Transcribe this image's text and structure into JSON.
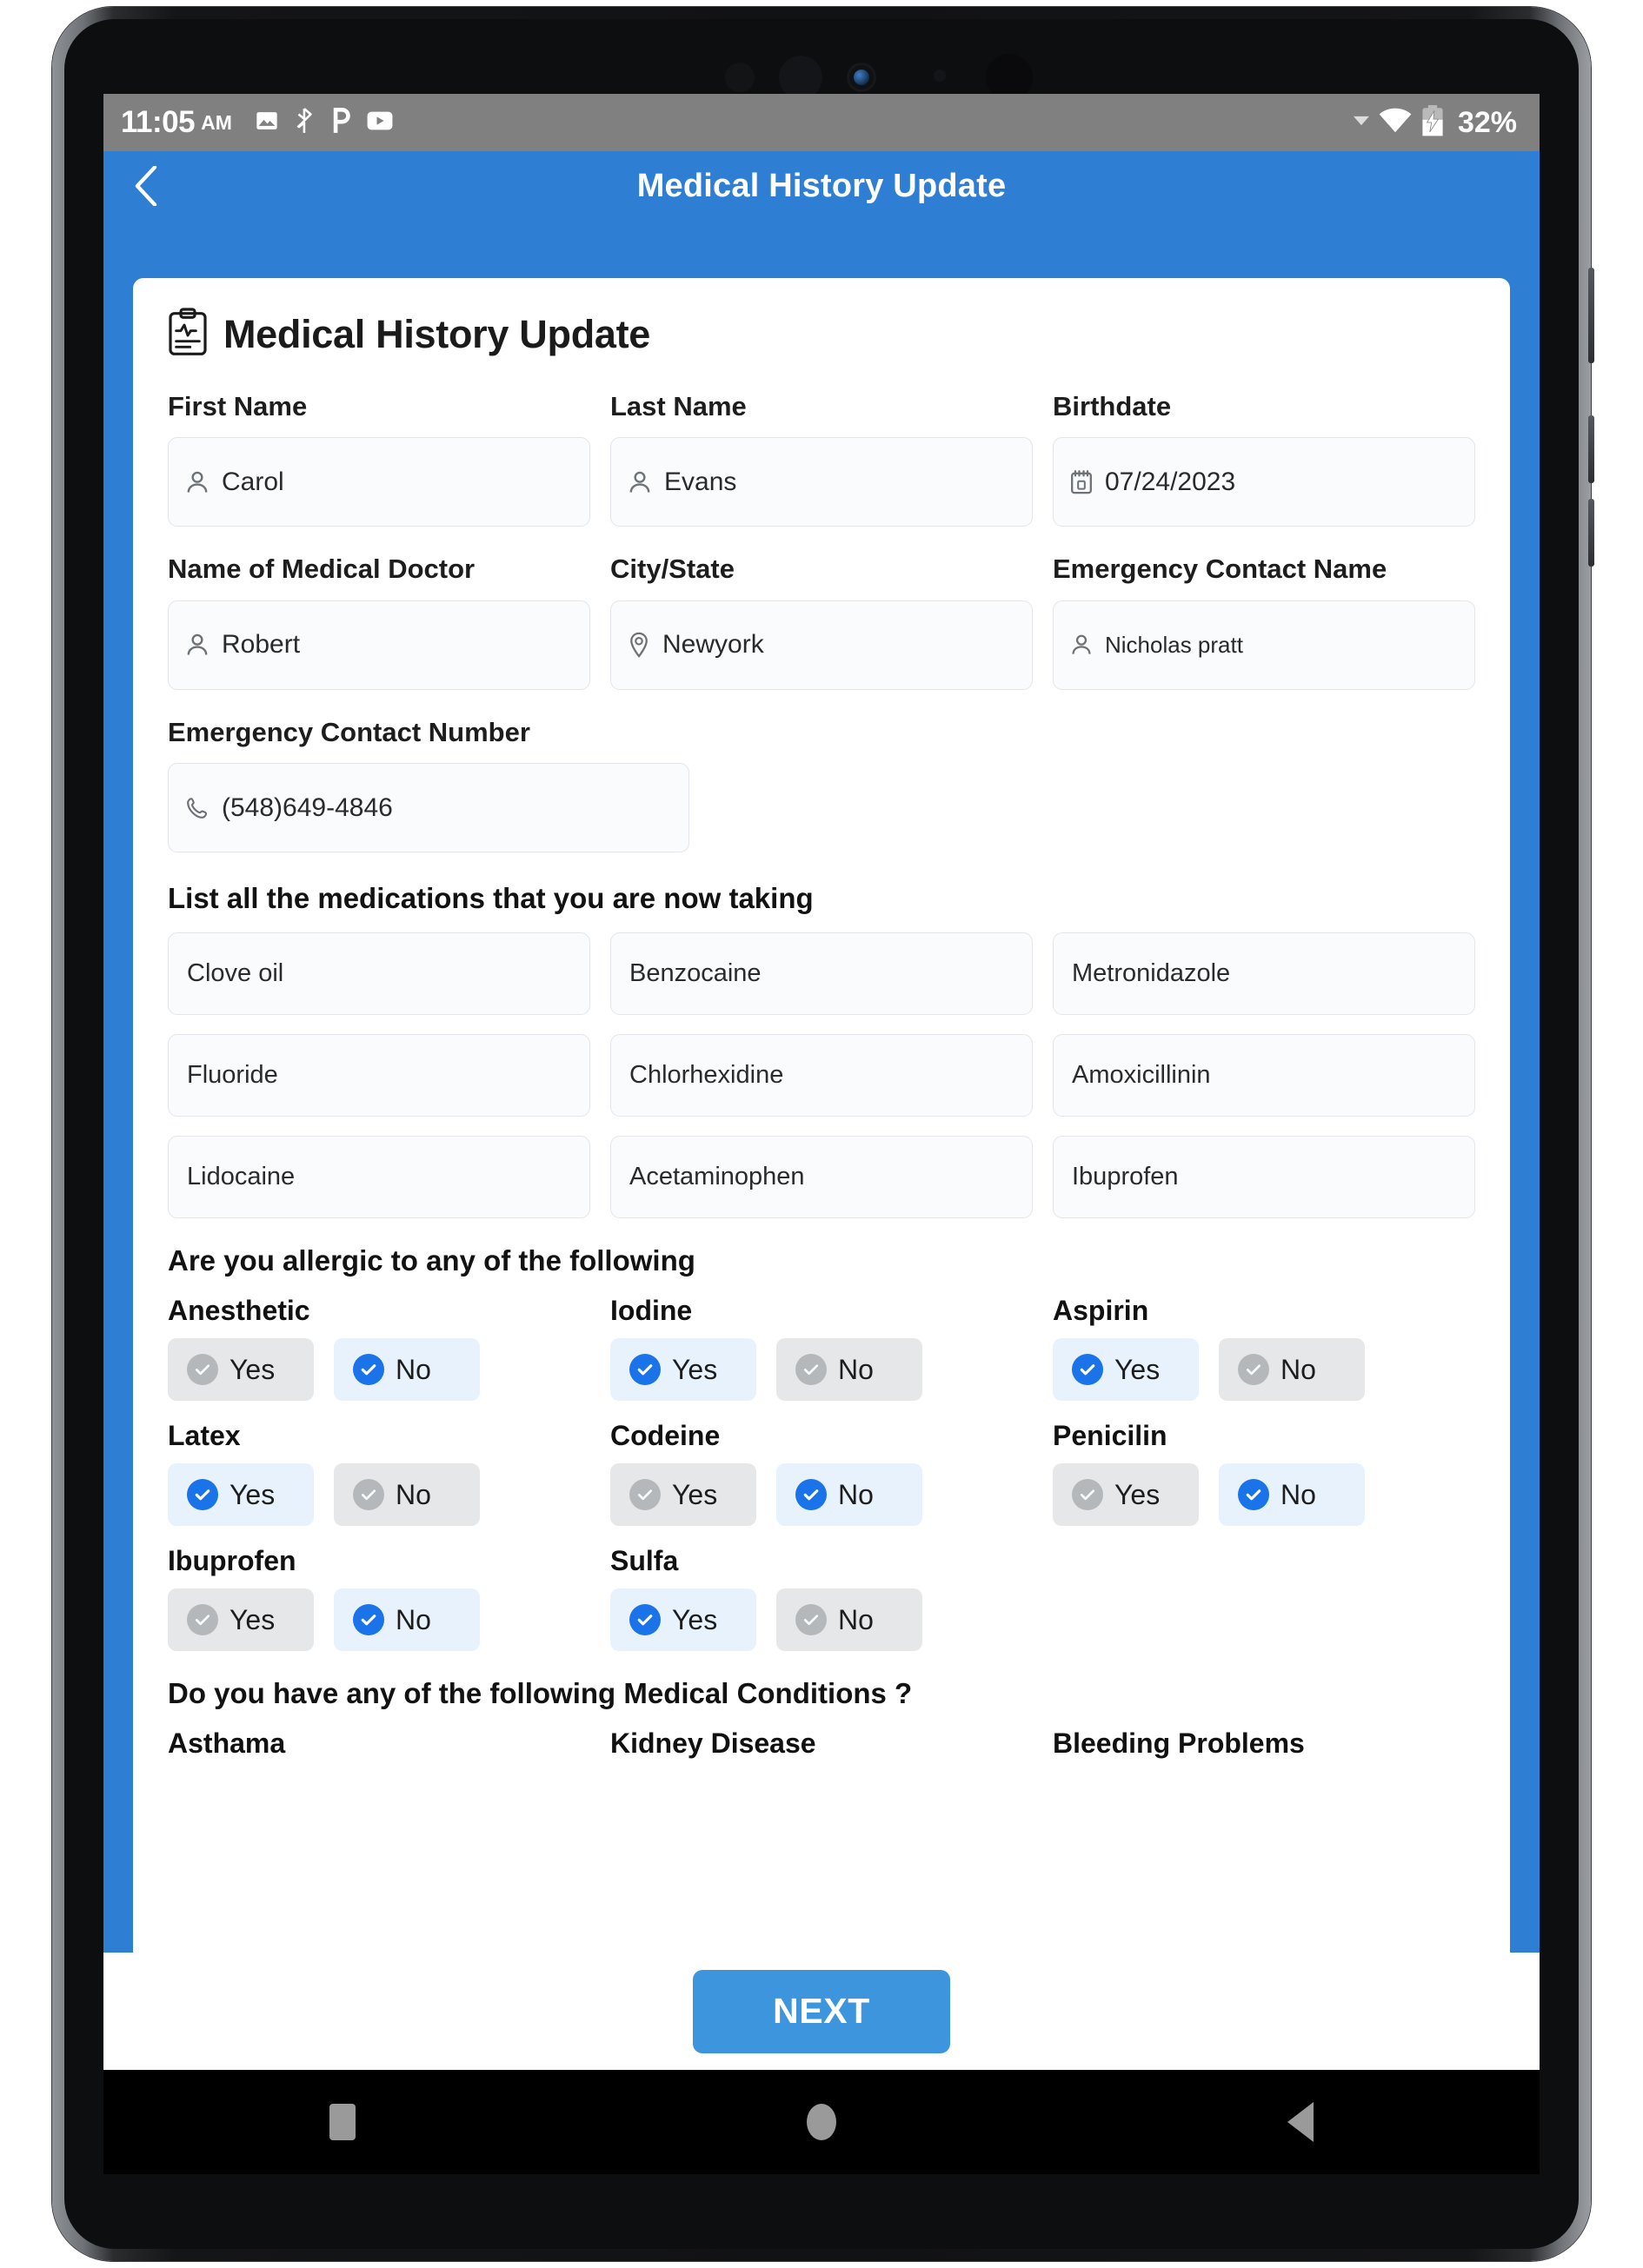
{
  "status_bar": {
    "time": "11:05",
    "ampm": "AM",
    "battery_percent": "32%",
    "left_icons": [
      "image-icon",
      "bluetooth-icon",
      "p-app-icon",
      "youtube-icon"
    ],
    "right_icons": [
      "dropdown-caret-icon",
      "wifi-icon",
      "battery-charging-icon"
    ]
  },
  "app_bar": {
    "back_icon": "chevron-left-icon",
    "title": "Medical History Update"
  },
  "card": {
    "icon": "clipboard-medical-icon",
    "title": "Medical History Update"
  },
  "form": {
    "first_name": {
      "label": "First Name",
      "value": "Carol",
      "icon": "person-icon"
    },
    "last_name": {
      "label": "Last Name",
      "value": "Evans",
      "icon": "person-icon"
    },
    "birthdate": {
      "label": "Birthdate",
      "value": "07/24/2023",
      "icon": "calendar-icon"
    },
    "doctor_name": {
      "label": "Name of Medical Doctor",
      "value": "Robert",
      "icon": "person-icon"
    },
    "city_state": {
      "label": "City/State",
      "value": "Newyork",
      "icon": "location-pin-icon"
    },
    "emergency_contact_name": {
      "label": "Emergency Contact Name",
      "value": "Nicholas pratt",
      "icon": "person-icon"
    },
    "emergency_contact_number": {
      "label": "Emergency Contact Number",
      "value": "(548)649-4846",
      "icon": "phone-icon"
    }
  },
  "medications": {
    "heading": "List all the medications that you are now taking",
    "items": [
      "Clove oil",
      "Benzocaine",
      "Metronidazole",
      "Fluoride",
      "Chlorhexidine",
      "Amoxicillinin",
      "Lidocaine",
      "Acetaminophen",
      "Ibuprofen"
    ]
  },
  "allergies": {
    "heading": "Are you allergic to any of the following",
    "yes_label": "Yes",
    "no_label": "No",
    "items": [
      {
        "name": "Anesthetic",
        "answer": "No"
      },
      {
        "name": "Iodine",
        "answer": "Yes"
      },
      {
        "name": "Aspirin",
        "answer": "Yes"
      },
      {
        "name": "Latex",
        "answer": "Yes"
      },
      {
        "name": "Codeine",
        "answer": "No"
      },
      {
        "name": "Penicilin",
        "answer": "No"
      },
      {
        "name": "Ibuprofen",
        "answer": "No"
      },
      {
        "name": "Sulfa",
        "answer": "Yes"
      }
    ]
  },
  "conditions": {
    "heading": "Do you have any of the following Medical Conditions ?",
    "items": [
      "Asthama",
      "Kidney Disease",
      "Bleeding Problems"
    ]
  },
  "footer": {
    "next_label": "NEXT"
  },
  "nav_bar": {
    "items": [
      "recents-square-icon",
      "home-circle-icon",
      "back-triangle-icon"
    ]
  },
  "colors": {
    "brand_blue": "#2e7fd4",
    "button_blue": "#3d96dd",
    "check_blue": "#1a73e8",
    "selected_bg": "#e8f2fd",
    "unselected_bg": "#e6e7e8"
  }
}
